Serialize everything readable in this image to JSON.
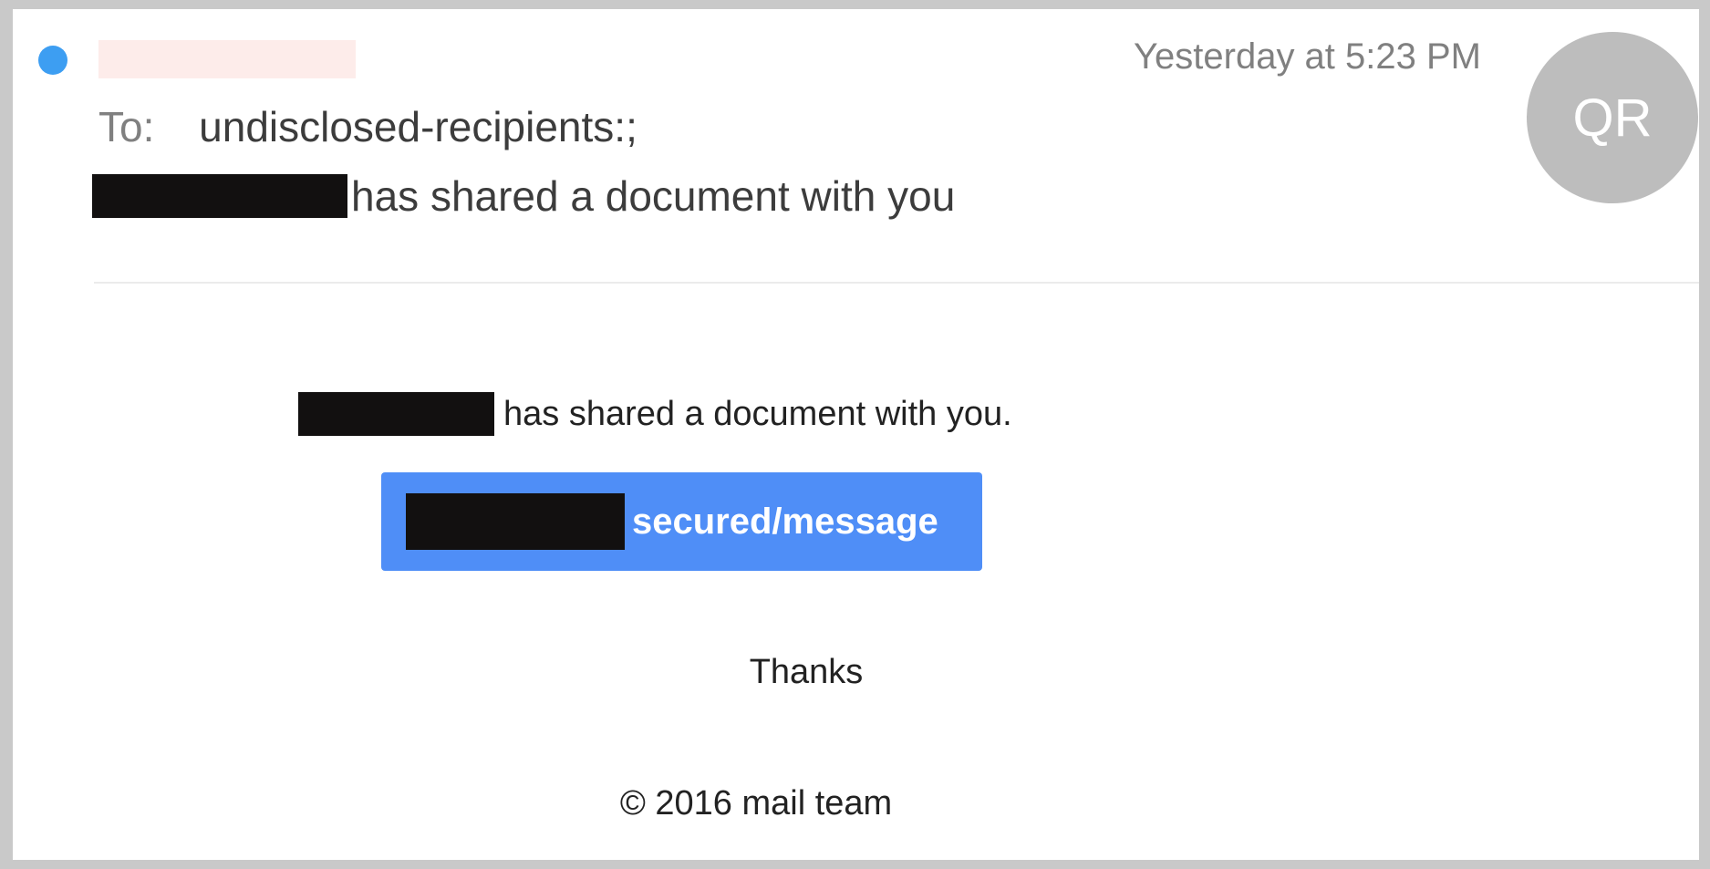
{
  "header": {
    "timestamp": "Yesterday at 5:23 PM",
    "avatar_initials": "QR",
    "to_label": "To:",
    "to_value": "undisclosed-recipients:;",
    "subject_text": "has shared a document with you",
    "unread_color": "#3d9ef2"
  },
  "body": {
    "message_text": "has shared a document with you.",
    "button_label": "secured/message",
    "button_color": "#4f8ef7",
    "thanks": "Thanks",
    "copyright": "© 2016 mail team"
  }
}
